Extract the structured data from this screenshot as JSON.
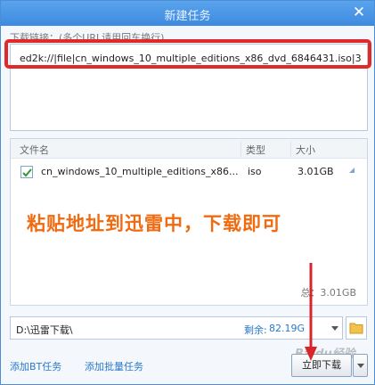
{
  "window": {
    "title": "新建任务"
  },
  "url_field": {
    "label": "下载链接：(多个URL请用回车换行)",
    "value": "ed2k://|file|cn_windows_10_multiple_editions_x86_dvd_6846431.iso|3"
  },
  "file_list": {
    "headers": {
      "name": "文件名",
      "type": "类型",
      "size": "大小"
    },
    "rows": [
      {
        "name": "cn_windows_10_multiple_editions_x86...",
        "type": "iso",
        "size": "3.01GB",
        "checked": true
      }
    ],
    "total": "总：3.01GB"
  },
  "annotation": {
    "text": "粘贴地址到迅雷中，下载即可",
    "color": "#f06a10"
  },
  "save_path": {
    "value": "D:\\迅雷下载\\",
    "remain_label": "剩余:",
    "remain_value": "82.19G"
  },
  "footer": {
    "add_bt": "添加BT任务",
    "add_batch": "添加批量任务",
    "download_now": "立即下载"
  },
  "watermark": "Baidu经验",
  "colors": {
    "accent": "#3d8ae0",
    "highlight_border": "#e02a2a",
    "link": "#2a79c8"
  },
  "icons": {
    "close": "close-icon",
    "folder": "folder-icon",
    "check": "checkmark-icon"
  }
}
